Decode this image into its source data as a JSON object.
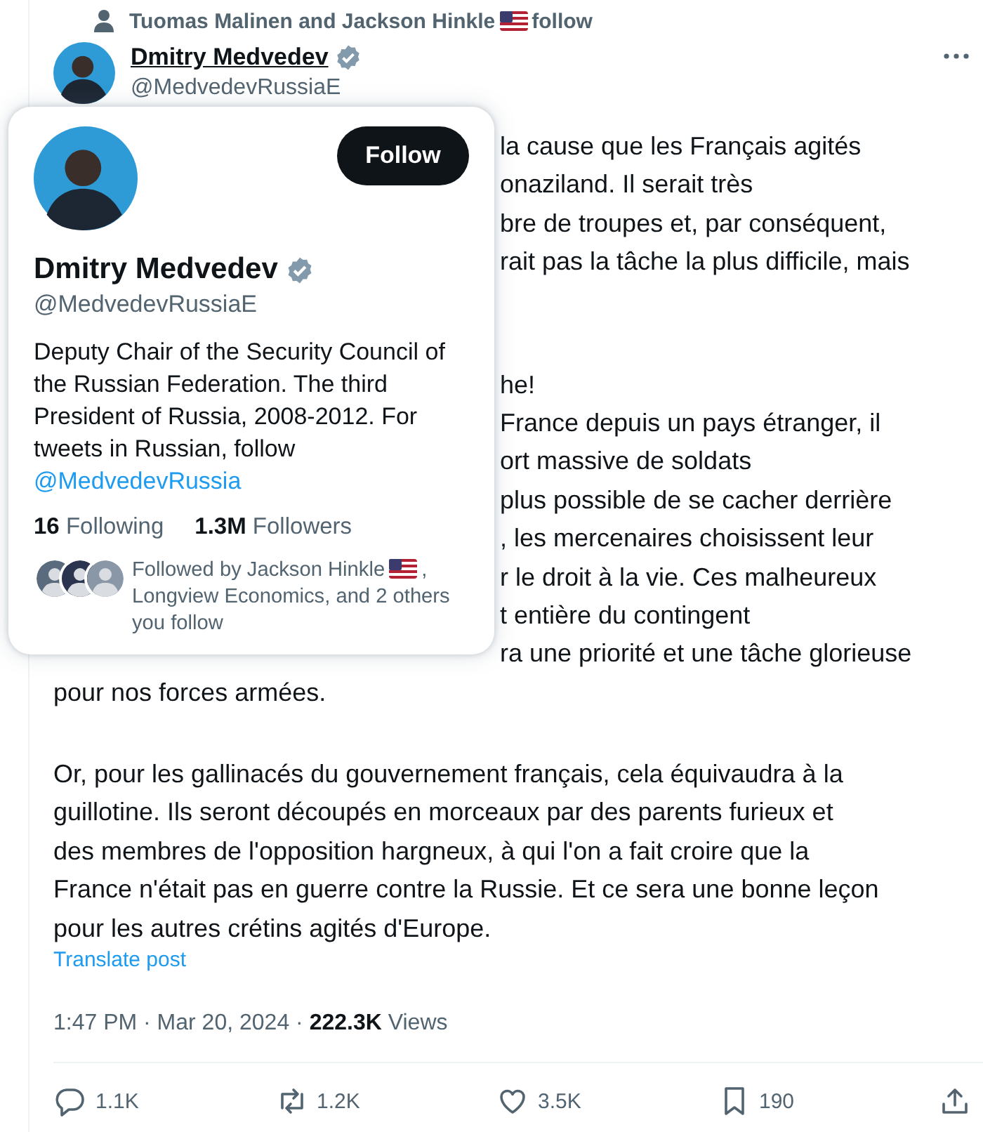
{
  "social_context": {
    "text": "Tuomas Malinen and Jackson Hinkle",
    "suffix": "follow"
  },
  "author": {
    "name": "Dmitry Medvedev",
    "verified": true,
    "handle": "@MedvedevRussiaE",
    "hovered": true
  },
  "hover_card": {
    "follow_button": "Follow",
    "name": "Dmitry Medvedev",
    "verified": true,
    "handle": "@MedvedevRussiaE",
    "bio": "Deputy Chair of the Security Council of the Russian Federation. The third President of Russia, 2008-2012. For tweets in Russian, follow ",
    "bio_link": "@MedvedevRussia",
    "stats": [
      {
        "text": "**16** Following"
      },
      {
        "text": "**1.3M** Followers"
      }
    ],
    "followed_by": {
      "text": "Followed by Jackson Hinkle",
      "comma": ",",
      "rest": "Longview Economics, and 2 others you follow"
    }
  },
  "post": {
    "paragraphs": [
      {
        "lines": [
          {
            "kind": "cut",
            "text": "la cause que les Français agités"
          },
          {
            "kind": "cut",
            "text": "onaziland. Il serait très"
          },
          {
            "kind": "cut",
            "text": "bre de troupes et, par conséquent,"
          },
          {
            "kind": "cut",
            "text": "rait pas la tâche la plus difficile, mais"
          }
        ]
      },
      {
        "lines": [
          {
            "kind": "cut",
            "text": "he!"
          },
          {
            "kind": "cut",
            "text": "France depuis un pays étranger, il"
          },
          {
            "kind": "cut",
            "text": "ort massive de soldats"
          },
          {
            "kind": "cut",
            "text": "plus possible de se cacher derrière"
          },
          {
            "kind": "cut",
            "text": ", les mercenaires choisissent leur"
          },
          {
            "kind": "cut",
            "text": "r le droit à la vie. Ces malheureux"
          },
          {
            "kind": "cut",
            "text": "t entière du contingent"
          },
          {
            "kind": "cut",
            "text": "ra une priorité et une tâche glorieuse"
          },
          {
            "kind": "full",
            "text": "pour nos forces armées."
          }
        ]
      },
      {
        "lines": [
          {
            "kind": "full",
            "text": "Or, pour les gallinacés du gouvernement français, cela équivaudra à la"
          },
          {
            "kind": "full",
            "text": "guillotine. Ils seront découpés en morceaux par des parents furieux et"
          },
          {
            "kind": "full",
            "text": "des membres de l'opposition hargneux, à qui l'on a fait croire que la"
          },
          {
            "kind": "full",
            "text": "France n'était pas en guerre contre la Russie. Et ce sera une bonne leçon"
          },
          {
            "kind": "full",
            "text": "pour les autres crétins agités d'Europe."
          }
        ]
      }
    ],
    "translate_link": "Translate post",
    "meta": "1:47 PM · Mar 20, 2024 · **222.3K** Views"
  },
  "actions": [
    {
      "kind": "reply",
      "count": "1.1K"
    },
    {
      "kind": "repost",
      "count": "1.2K"
    },
    {
      "kind": "like",
      "count": "3.5K"
    },
    {
      "kind": "bookmark",
      "count": "190"
    },
    {
      "kind": "share"
    }
  ]
}
